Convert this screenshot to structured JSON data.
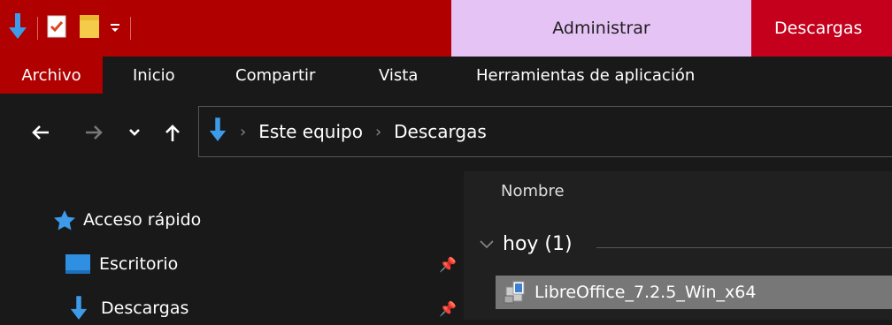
{
  "titlebar": {
    "context_admin": "Administrar",
    "context_downloads": "Descargas"
  },
  "ribbon": {
    "tabs": [
      {
        "label": "Archivo",
        "active": true
      },
      {
        "label": "Inicio"
      },
      {
        "label": "Compartir"
      },
      {
        "label": "Vista"
      },
      {
        "label": "Herramientas de aplicación"
      }
    ]
  },
  "address": {
    "crumbs": [
      "Este equipo",
      "Descargas"
    ]
  },
  "nav_pane": {
    "items": [
      {
        "label": "Acceso rápido",
        "icon": "star-icon"
      },
      {
        "label": "Escritorio",
        "icon": "desktop-icon"
      },
      {
        "label": "Descargas",
        "icon": "download-arrow-icon"
      }
    ]
  },
  "file_list": {
    "column_name": "Nombre",
    "group_label": "hoy (1)",
    "files": [
      {
        "name": "LibreOffice_7.2.5_Win_x64"
      }
    ]
  },
  "colors": {
    "titlebar": "#b00000",
    "context_admin": "#e6c3f5",
    "context_downloads": "#c4001c",
    "background": "#191919",
    "selection": "#777777"
  }
}
